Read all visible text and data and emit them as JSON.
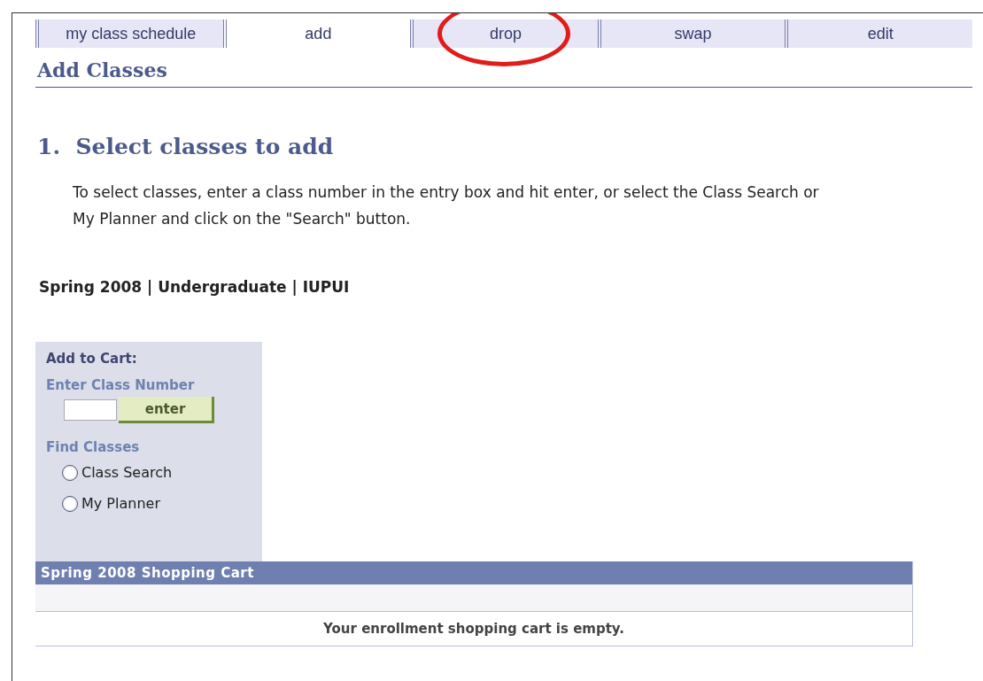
{
  "tabs": [
    {
      "label": "my class schedule",
      "selected": false,
      "circled": false
    },
    {
      "label": "add",
      "selected": true,
      "circled": false
    },
    {
      "label": "drop",
      "selected": false,
      "circled": true
    },
    {
      "label": "swap",
      "selected": false,
      "circled": false
    },
    {
      "label": "edit",
      "selected": false,
      "circled": false
    }
  ],
  "page_title": "Add Classes",
  "step_title": "1.  Select classes to add",
  "instructions": "To select classes, enter a class number in the entry box and hit enter, or select the Class Search or My Planner and click on the \"Search\" button.",
  "term": "Spring 2008 | Undergraduate | IUPUI",
  "cart_box": {
    "title": "Add to Cart:",
    "class_number_label": "Enter Class Number",
    "enter_button": "enter",
    "find_label": "Find Classes",
    "options": [
      {
        "label": "Class Search",
        "selected": false
      },
      {
        "label": "My Planner",
        "selected": false
      }
    ]
  },
  "shopping_cart": {
    "title": "Spring 2008 Shopping Cart",
    "message": "Your enrollment shopping cart is empty."
  }
}
